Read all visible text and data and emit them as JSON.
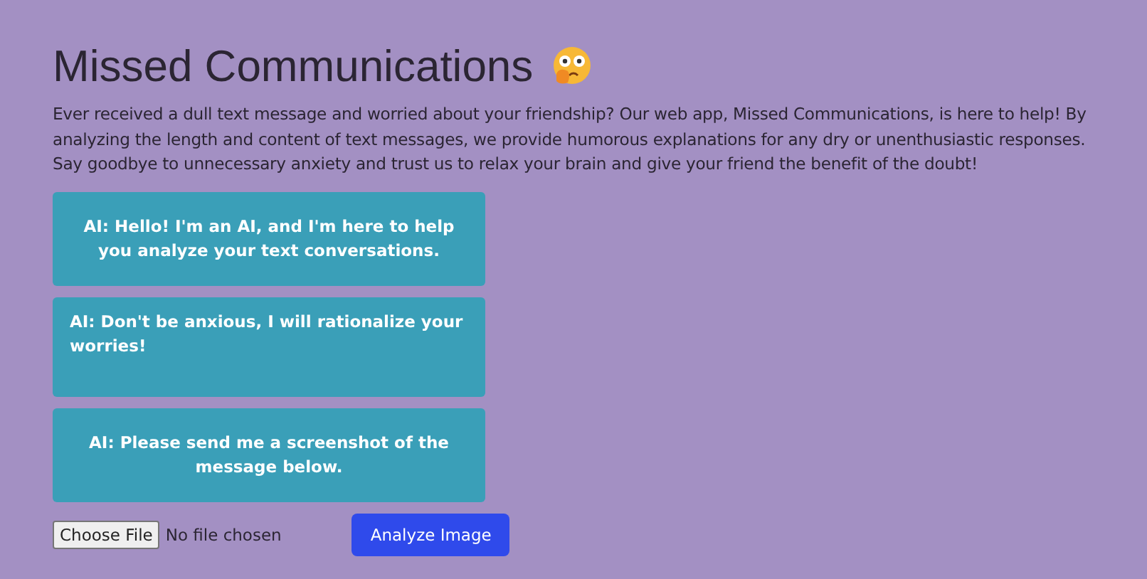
{
  "title": "Missed Communications",
  "description": "Ever received a dull text message and worried about your friendship? Our web app, Missed Communications, is here to help! By analyzing the length and content of text messages, we provide humorous explanations for any dry or unenthusiastic responses. Say goodbye to unnecessary anxiety and trust us to relax your brain and give your friend the benefit of the doubt!",
  "messages": [
    {
      "text": "AI: Hello! I'm an AI, and I'm here to help you analyze your text conversations."
    },
    {
      "text": "AI: Don't be anxious, I will rationalize your worries!"
    },
    {
      "text": "AI: Please send me a screenshot of the message below."
    }
  ],
  "file_input": {
    "button": "Choose File",
    "status": "No file chosen"
  },
  "submit_button": "Analyze Image"
}
